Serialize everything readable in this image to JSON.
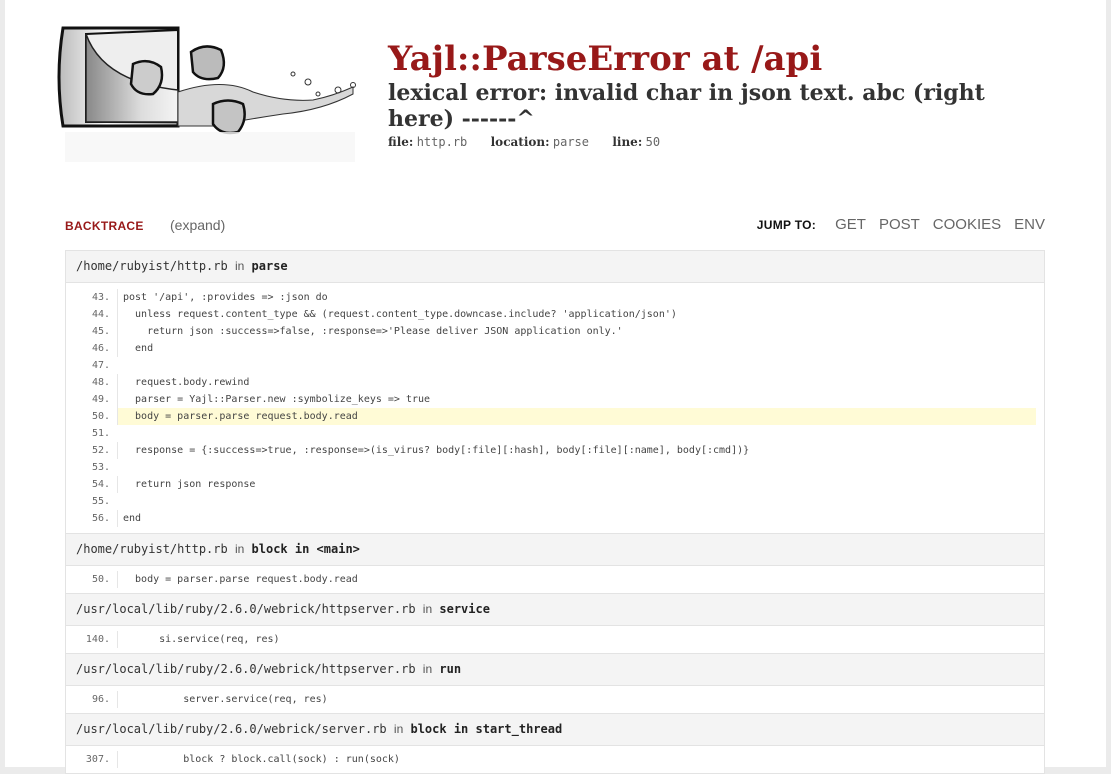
{
  "error": {
    "title": "Yajl::ParseError at /api",
    "message": "lexical error: invalid char in json text. abc (right here) ------^",
    "meta": [
      {
        "key": "file:",
        "value": "http.rb"
      },
      {
        "key": "location:",
        "value": "parse"
      },
      {
        "key": "line:",
        "value": "50"
      }
    ]
  },
  "nav": {
    "backtrace_label": "BACKTRACE",
    "expand_label": "(expand)",
    "jump_label": "JUMP TO:",
    "jump_links": [
      "GET",
      "POST",
      "COOKIES",
      "ENV"
    ]
  },
  "connector": "in",
  "frames": [
    {
      "path": "/home/rubyist/http.rb",
      "function": "parse",
      "lines": [
        {
          "n": "43.",
          "code": "post '/api', :provides => :json do",
          "hl": false
        },
        {
          "n": "44.",
          "code": "  unless request.content_type && (request.content_type.downcase.include? 'application/json')",
          "hl": false
        },
        {
          "n": "45.",
          "code": "    return json :success=>false, :response=>'Please deliver JSON application only.'",
          "hl": false
        },
        {
          "n": "46.",
          "code": "  end",
          "hl": false
        },
        {
          "n": "47.",
          "code": "",
          "hl": false
        },
        {
          "n": "48.",
          "code": "  request.body.rewind",
          "hl": false
        },
        {
          "n": "49.",
          "code": "  parser = Yajl::Parser.new :symbolize_keys => true",
          "hl": false
        },
        {
          "n": "50.",
          "code": "  body = parser.parse request.body.read",
          "hl": true
        },
        {
          "n": "51.",
          "code": "",
          "hl": false
        },
        {
          "n": "52.",
          "code": "  response = {:success=>true, :response=>(is_virus? body[:file][:hash], body[:file][:name], body[:cmd])}",
          "hl": false
        },
        {
          "n": "53.",
          "code": "",
          "hl": false
        },
        {
          "n": "54.",
          "code": "  return json response",
          "hl": false
        },
        {
          "n": "55.",
          "code": "",
          "hl": false
        },
        {
          "n": "56.",
          "code": "end",
          "hl": false
        }
      ]
    },
    {
      "path": "/home/rubyist/http.rb",
      "function": "block in <main>",
      "lines": [
        {
          "n": "50.",
          "code": "  body = parser.parse request.body.read",
          "hl": false
        }
      ]
    },
    {
      "path": "/usr/local/lib/ruby/2.6.0/webrick/httpserver.rb",
      "function": "service",
      "lines": [
        {
          "n": "140.",
          "code": "      si.service(req, res)",
          "hl": false
        }
      ]
    },
    {
      "path": "/usr/local/lib/ruby/2.6.0/webrick/httpserver.rb",
      "function": "run",
      "lines": [
        {
          "n": "96.",
          "code": "          server.service(req, res)",
          "hl": false
        }
      ]
    },
    {
      "path": "/usr/local/lib/ruby/2.6.0/webrick/server.rb",
      "function": "block in start_thread",
      "lines": [
        {
          "n": "307.",
          "code": "          block ? block.call(sock) : run(sock)",
          "hl": false
        }
      ]
    }
  ]
}
